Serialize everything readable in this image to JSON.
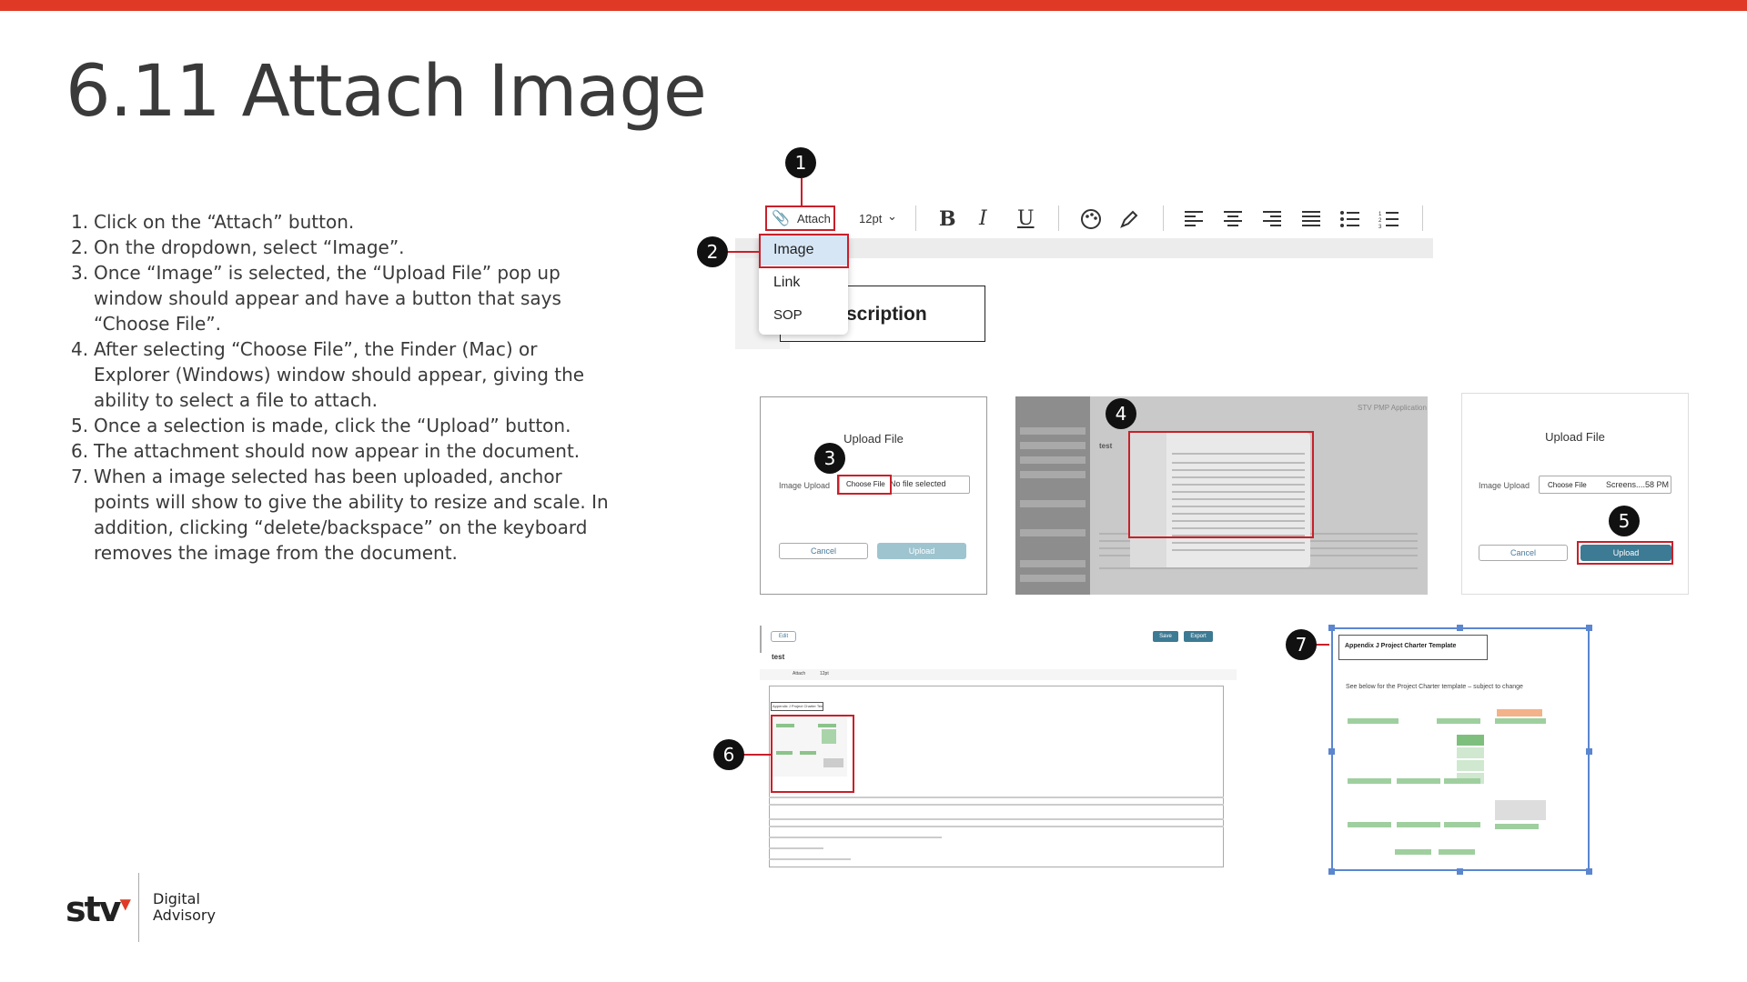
{
  "slide": {
    "title": "6.11 Attach Image",
    "steps": [
      {
        "num": "1.",
        "text": "Click on the “Attach” button."
      },
      {
        "num": "2.",
        "text": "On the dropdown, select “Image”."
      },
      {
        "num": "3.",
        "text": "Once “Image” is selected, the “Upload File” pop up window should appear and have a button that says “Choose File”."
      },
      {
        "num": "4.",
        "text": "After selecting “Choose File”, the Finder (Mac) or Explorer (Windows) window should appear, giving the ability to select a file to attach."
      },
      {
        "num": "5.",
        "text": "Once a selection is made, click the “Upload” button."
      },
      {
        "num": "6.",
        "text": "The attachment should now appear in the document."
      },
      {
        "num": "7.",
        "text": "When a image selected has been uploaded, anchor points will show to give the ability to resize and scale. In addition, clicking “delete/backspace” on the keyboard removes the image from the document."
      }
    ],
    "accent_color": "#e03a26"
  },
  "badges": [
    "1",
    "2",
    "3",
    "4",
    "5",
    "6",
    "7"
  ],
  "toolbar": {
    "attach_label": "Attach",
    "font_size": "12pt",
    "dropdown": [
      "Image",
      "Link",
      "SOP"
    ],
    "doc_heading_fragment": "scription"
  },
  "upload_dialog_1": {
    "title": "Upload File",
    "field_label": "Image Upload",
    "choose_label": "Choose File",
    "file_status": "No file selected",
    "cancel": "Cancel",
    "upload": "Upload"
  },
  "upload_dialog_2": {
    "title": "Upload File",
    "field_label": "Image Upload",
    "choose_label": "Choose File",
    "file_name": "Screens....58 PM",
    "cancel": "Cancel",
    "upload": "Upload"
  },
  "finder_shot": {
    "app_name": "STV PMP Application",
    "doc_title": "test"
  },
  "doc_shot": {
    "edit_label": "Edit",
    "save_label": "Save",
    "export_label": "Export",
    "doc_title": "test",
    "attach_label": "Attach",
    "font_size": "12pt",
    "appendix_title": "Appendix J Project Charter Template"
  },
  "resize_shot": {
    "appendix_title": "Appendix J Project Charter Template",
    "subtitle": "See below for the Project Charter template – subject to change"
  },
  "footer": {
    "logo": "stv",
    "line1": "Digital",
    "line2": "Advisory"
  }
}
